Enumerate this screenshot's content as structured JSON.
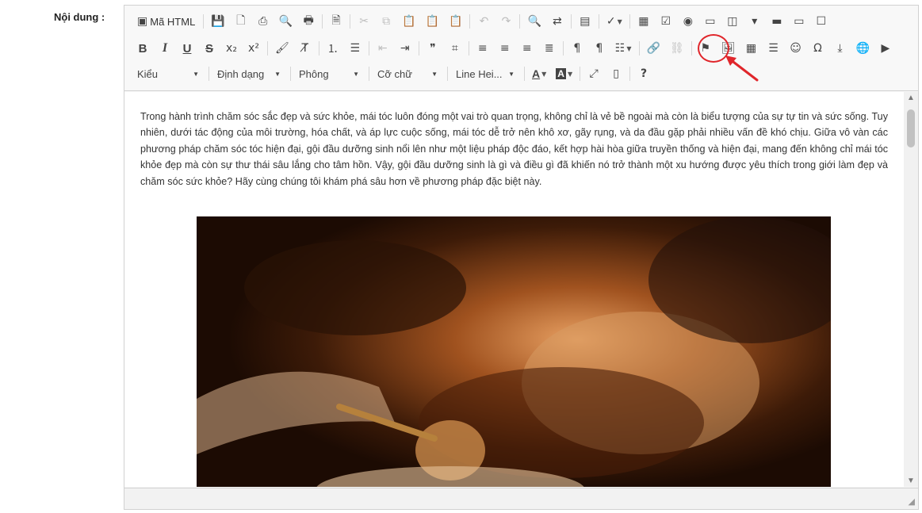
{
  "form": {
    "label": "Nội dung :"
  },
  "toolbar": {
    "source_label": "Mã HTML",
    "combos": {
      "style": "Kiểu",
      "format": "Định dạng",
      "font": "Phông",
      "size": "Cỡ chữ",
      "line_height": "Line Hei..."
    },
    "highlighted_button": "image-icon",
    "highlight_color": "#e0262b"
  },
  "content": {
    "paragraph": "Trong hành trình chăm sóc sắc đẹp và sức khỏe, mái tóc luôn đóng một vai trò quan trọng, không chỉ là vẻ bề ngoài mà còn là biểu tượng của sự tự tin và sức sống. Tuy nhiên, dưới tác động của môi trường, hóa chất, và áp lực cuộc sống, mái tóc dễ trở nên khô xơ, gãy rụng, và da đầu gặp phải nhiều vấn đề khó chịu. Giữa vô vàn các phương pháp chăm sóc tóc hiện đại, gội đầu dưỡng sinh nổi lên như một liệu pháp độc đáo, kết hợp hài hòa giữa truyền thống và hiện đại, mang đến không chỉ mái tóc khỏe đẹp mà còn sự thư thái sâu lắng cho tâm hồn. Vậy, gội đầu dưỡng sinh là gì và điều gì đã khiến nó trở thành một xu hướng được yêu thích trong giới làm đẹp và chăm sóc sức khỏe? Hãy cùng chúng tôi khám phá sâu hơn về phương pháp đặc biệt này."
  }
}
